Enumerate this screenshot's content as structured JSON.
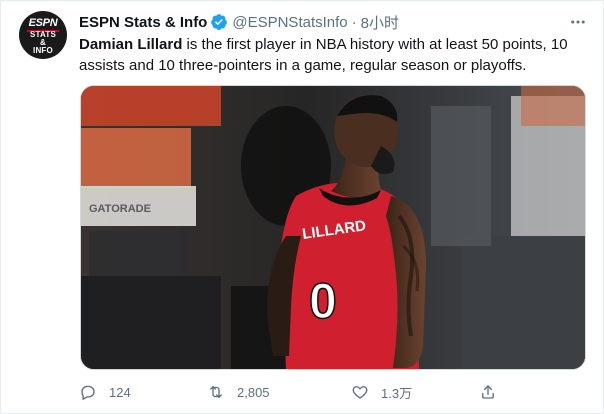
{
  "account": {
    "avatar_text_top": "ESPN",
    "avatar_text_line1": "STATS",
    "avatar_text_line2": "&",
    "avatar_text_line3": "INFO",
    "display_name": "ESPN Stats & Info",
    "verified": true,
    "handle": "@ESPNStatsInfo",
    "separator": "·",
    "time": "8小时"
  },
  "tweet": {
    "bold_text": "Damian Lillard",
    "text": " is the first player in NBA history with at least 50 points, 10 assists and 10 three-pointers in a game, regular season or playoffs."
  },
  "media": {
    "jersey_name": "LILLARD",
    "jersey_number": "0",
    "background_sign": "GATORADE"
  },
  "actions": {
    "replies": "124",
    "retweets": "2,805",
    "likes": "1.3万"
  },
  "colors": {
    "verified_blue": "#1da1f2",
    "secondary_text": "#5b7083",
    "jersey_red": "#d01f2e",
    "espn_red": "#d0021b"
  },
  "icons": [
    "verified-badge-icon",
    "more-icon",
    "reply-icon",
    "retweet-icon",
    "like-icon",
    "share-icon"
  ]
}
